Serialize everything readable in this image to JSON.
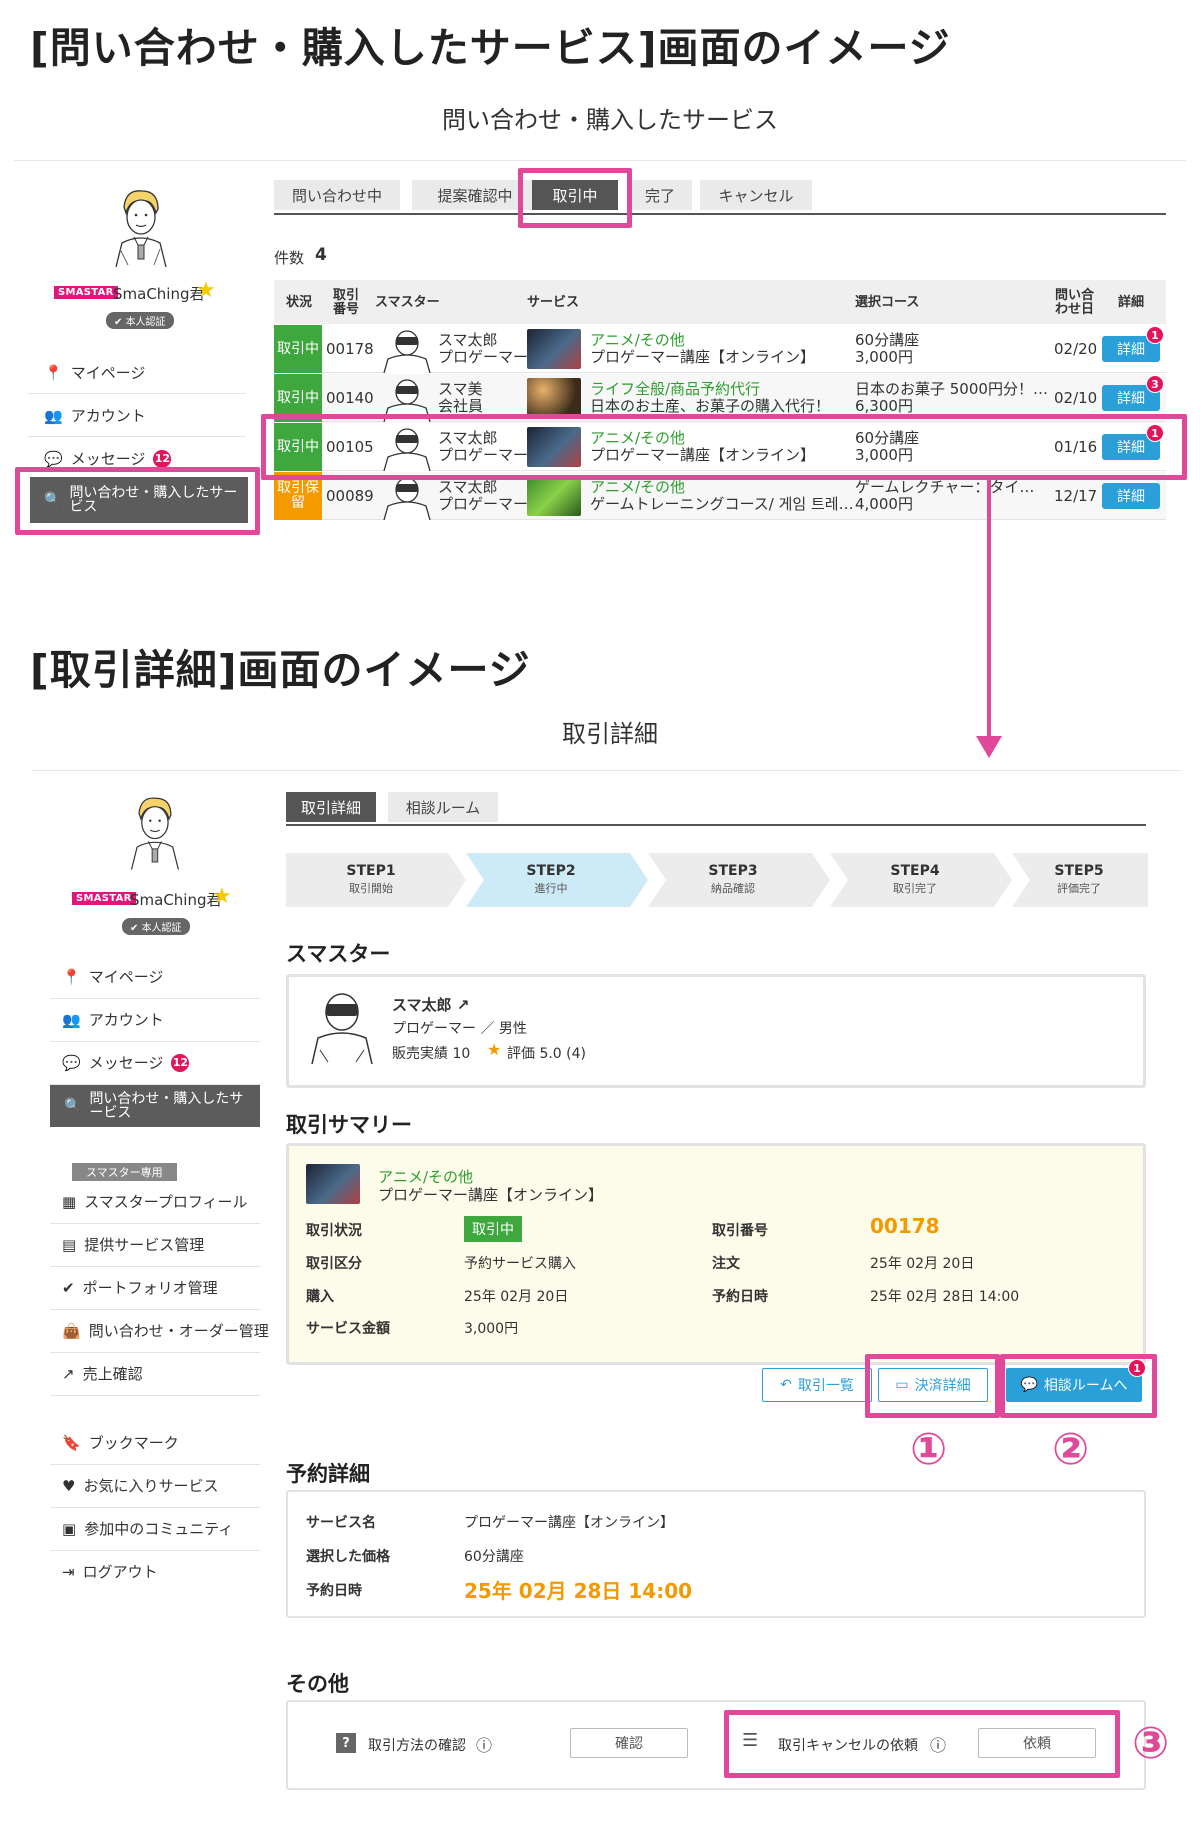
{
  "section1": {
    "heading": "[問い合わせ・購入したサービス]画面のイメージ",
    "page_title": "問い合わせ・購入したサービス",
    "tabs": [
      "問い合わせ中",
      "提案確認中",
      "取引中",
      "完了",
      "キャンセル"
    ],
    "count_label": "件数",
    "count_value": "4",
    "headers": {
      "status": "状況",
      "trade_no": "取引番号",
      "smaster": "スマスター",
      "service": "サービス",
      "course": "選択コース",
      "inquiry_date": "問い合わせ日",
      "detail": "詳細"
    },
    "rows": [
      {
        "status": "取引中",
        "no": "00178",
        "name": "スマ太郎",
        "role": "プロゲーマー",
        "category": "アニメ/その他",
        "service": "プロゲーマー講座【オンライン】",
        "course": "60分講座",
        "price": "3,000円",
        "date": "02/20",
        "detail": "詳細",
        "badge": "1",
        "color": "#3ea83e"
      },
      {
        "status": "取引中",
        "no": "00140",
        "name": "スマ美",
        "role": "会社員",
        "category": "ライフ全般/商品予約代行",
        "service": "日本のお土産、お菓子の購入代行！",
        "course": "日本のお菓子 5000円分！…",
        "price": "6,300円",
        "date": "02/10",
        "detail": "詳細",
        "badge": "3",
        "color": "#3ea83e"
      },
      {
        "status": "取引中",
        "no": "00105",
        "name": "スマ太郎",
        "role": "プロゲーマー",
        "category": "アニメ/その他",
        "service": "プロゲーマー講座【オンライン】",
        "course": "60分講座",
        "price": "3,000円",
        "date": "01/16",
        "detail": "詳細",
        "badge": "1",
        "color": "#3ea83e"
      },
      {
        "status": "取引保留",
        "no": "00089",
        "name": "スマ太郎",
        "role": "プロゲーマー",
        "category": "アニメ/その他",
        "service": "ゲームトレーニングコース/ 게임 트레…",
        "course": "ゲームレクチャー：タイ…",
        "price": "4,000円",
        "date": "12/17",
        "detail": "詳細",
        "badge": "",
        "color": "#f29a00"
      }
    ]
  },
  "profile": {
    "logo": "SMASTAR",
    "name": "SmaChing君",
    "verified": "本人認証"
  },
  "sidebar1": [
    {
      "label": "マイページ",
      "icon": "pin-icon"
    },
    {
      "label": "アカウント",
      "icon": "account-icon"
    },
    {
      "label": "メッセージ",
      "icon": "message-icon",
      "badge": "12"
    },
    {
      "label": "問い合わせ・購入したサービス",
      "icon": "search-doc-icon",
      "active": true
    }
  ],
  "section2": {
    "heading": "[取引詳細]画面のイメージ",
    "page_title": "取引詳細",
    "tabs": [
      "取引詳細",
      "相談ルーム"
    ],
    "steps": [
      {
        "title": "STEP1",
        "sub": "取引開始"
      },
      {
        "title": "STEP2",
        "sub": "進行中"
      },
      {
        "title": "STEP3",
        "sub": "納品確認"
      },
      {
        "title": "STEP4",
        "sub": "取引完了"
      },
      {
        "title": "STEP5",
        "sub": "評価完了"
      }
    ],
    "smaster_heading": "スマスター",
    "smaster": {
      "name": "スマ太郎",
      "role": "プロゲーマー ／ 男性",
      "sales": "販売実績 10",
      "rating": "評価 5.0 (4)"
    },
    "summary_heading": "取引サマリー",
    "summary": {
      "category": "アニメ/その他",
      "service": "プロゲーマー講座【オンライン】",
      "status_label": "取引状況",
      "status_value": "取引中",
      "no_label": "取引番号",
      "no_value": "00178",
      "type_label": "取引区分",
      "type_value": "予約サービス購入",
      "order_label": "注文",
      "order_value": "25年 02月 20日",
      "purchase_label": "購入",
      "purchase_value": "25年 02月 20日",
      "reserve_label": "予約日時",
      "reserve_value": "25年 02月 28日 14:00",
      "price_label": "サービス金額",
      "price_value": "3,000円"
    },
    "buttons": {
      "list": "取引一覧",
      "payment": "決済詳細",
      "room": "相談ルームへ",
      "room_badge": "1"
    },
    "callouts": [
      "①",
      "②",
      "③"
    ],
    "reservation_heading": "予約詳細",
    "reservation": {
      "service_label": "サービス名",
      "service_value": "プロゲーマー講座【オンライン】",
      "price_label": "選択した価格",
      "price_value": "60分講座",
      "date_label": "予約日時",
      "date_value": "25年 02月 28日 14:00"
    },
    "other_heading": "その他",
    "other": {
      "method_label": "取引方法の確認",
      "method_btn": "確認",
      "cancel_label": "取引キャンセルの依頼",
      "cancel_btn": "依頼"
    }
  },
  "sidebar2": {
    "items": [
      {
        "label": "マイページ",
        "icon": "pin-icon"
      },
      {
        "label": "アカウント",
        "icon": "account-icon"
      },
      {
        "label": "メッセージ",
        "icon": "message-icon",
        "badge": "12"
      },
      {
        "label": "問い合わせ・購入したサービス",
        "icon": "search-doc-icon",
        "active": true
      }
    ],
    "smaster_only": "スマスター専用",
    "smaster_items": [
      {
        "label": "スマスタープロフィール",
        "icon": "grid-icon"
      },
      {
        "label": "提供サービス管理",
        "icon": "calendar-icon"
      },
      {
        "label": "ポートフォリオ管理",
        "icon": "check-icon"
      },
      {
        "label": "問い合わせ・オーダー管理",
        "icon": "bag-icon"
      },
      {
        "label": "売上確認",
        "icon": "chart-icon"
      }
    ],
    "bottom_items": [
      {
        "label": "ブックマーク",
        "icon": "bookmark-icon"
      },
      {
        "label": "お気に入りサービス",
        "icon": "heart-icon"
      },
      {
        "label": "参加中のコミュニティ",
        "icon": "community-icon"
      },
      {
        "label": "ログアウト",
        "icon": "logout-icon"
      }
    ]
  }
}
